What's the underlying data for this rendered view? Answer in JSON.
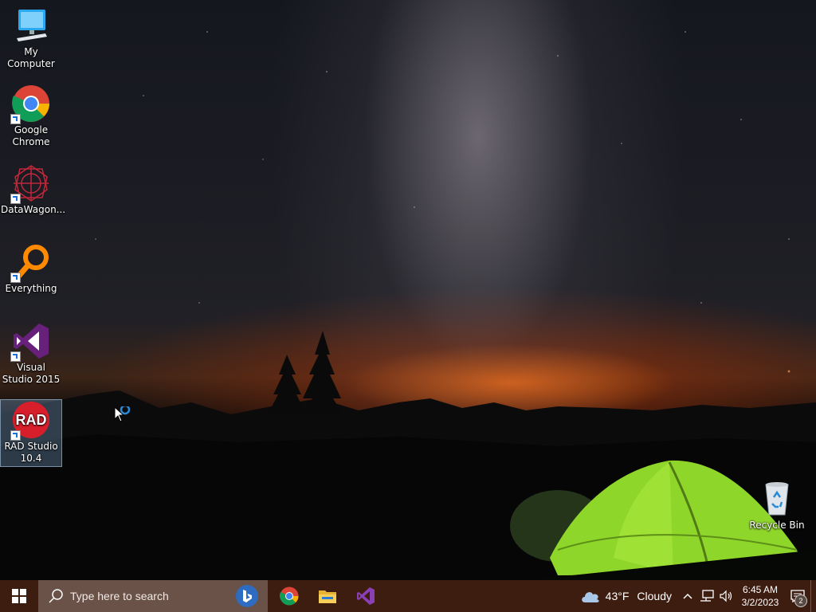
{
  "desktop": {
    "icons": [
      {
        "label": "My Computer",
        "icon": "monitor-icon",
        "shortcut": false,
        "selected": false
      },
      {
        "label": "Google Chrome",
        "icon": "chrome-icon",
        "shortcut": true,
        "selected": false
      },
      {
        "label": "DataWagon...",
        "icon": "datawagon-icon",
        "shortcut": true,
        "selected": false
      },
      {
        "label": "Everything",
        "icon": "everything-icon",
        "shortcut": true,
        "selected": false
      },
      {
        "label": "Visual Studio 2015",
        "icon": "visual-studio-icon",
        "shortcut": true,
        "selected": false
      },
      {
        "label": "RAD Studio 10.4",
        "icon": "rad-studio-icon",
        "shortcut": true,
        "selected": true
      }
    ],
    "recycle_bin": {
      "label": "Recycle Bin",
      "icon": "recycle-bin-icon"
    },
    "rad_icon_text": "RAD"
  },
  "taskbar": {
    "search_placeholder": "Type here to search",
    "pinned": [
      "chrome-icon",
      "file-explorer-icon",
      "visual-studio-icon"
    ],
    "weather": {
      "temp": "43°F",
      "condition": "Cloudy"
    },
    "clock": {
      "time": "6:45 AM",
      "date": "3/2/2023"
    },
    "notification_count": "2"
  },
  "colors": {
    "taskbar": "#3e1d11",
    "search_box": "#6b5248",
    "tent_green": "#8fd62b"
  }
}
